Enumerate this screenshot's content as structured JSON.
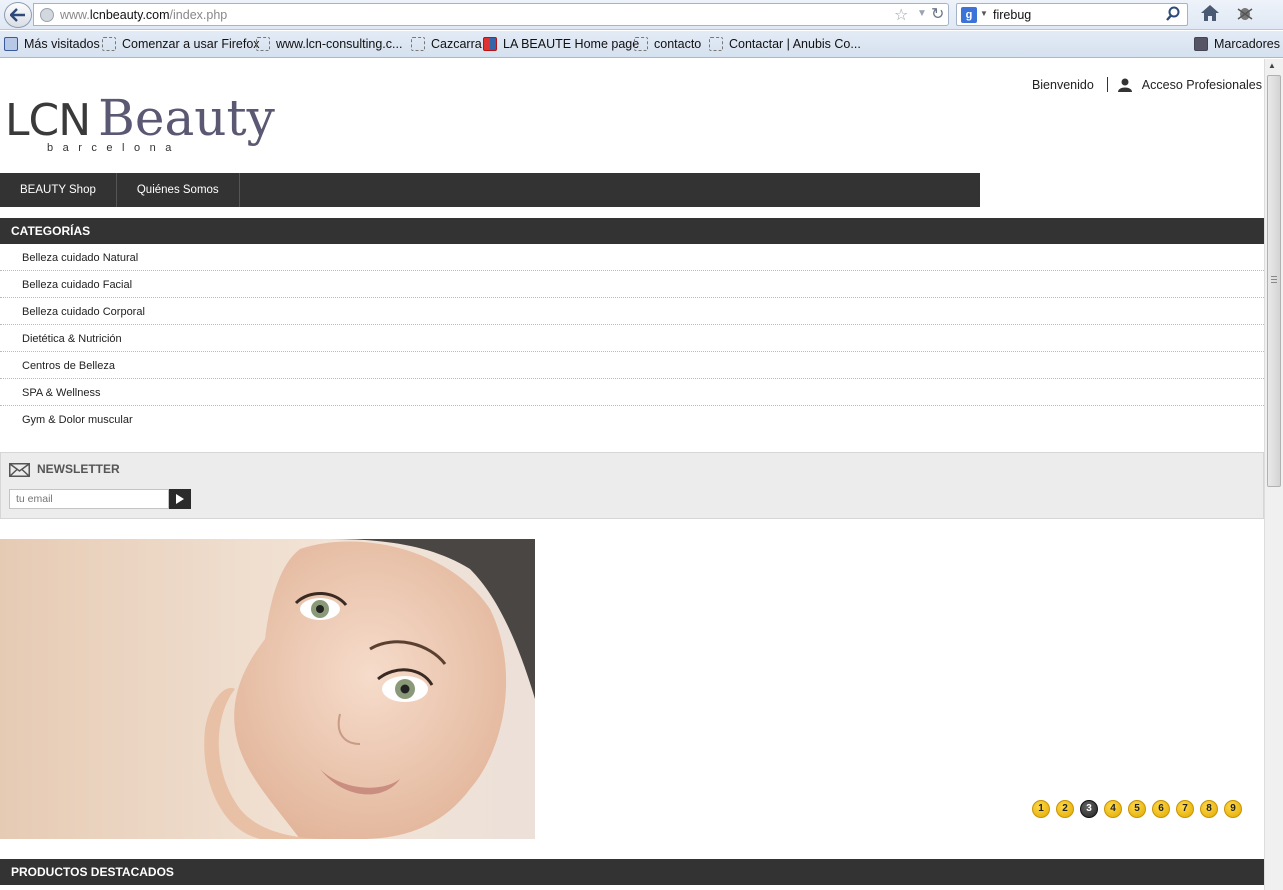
{
  "browser": {
    "url_prefix": "www.",
    "url_domain": "lcnbeauty.com",
    "url_path": "/index.php",
    "search_value": "firebug",
    "bookmarks": [
      {
        "label": "Más visitados",
        "icon": "most-visited-icon"
      },
      {
        "label": "Comenzar a usar Firefox",
        "icon": "page-icon"
      },
      {
        "label": "www.lcn-consulting.c...",
        "icon": "page-icon"
      },
      {
        "label": "Cazcarra",
        "icon": "page-icon"
      },
      {
        "label": "LA BEAUTE Home page",
        "icon": "site-icon"
      },
      {
        "label": "contacto",
        "icon": "page-icon"
      },
      {
        "label": "Contactar | Anubis Co...",
        "icon": "page-icon"
      }
    ],
    "bookmarks_menu_label": "Marcadores"
  },
  "site": {
    "logo_main": "LCN",
    "logo_accent": "Beauty",
    "logo_sub": "barcelona",
    "welcome": "Bienvenido",
    "pro_access": "Acceso Profesionales",
    "nav": [
      "BEAUTY Shop",
      "Quiénes Somos"
    ],
    "categories_title": "CATEGORÍAS",
    "categories": [
      "Belleza cuidado Natural",
      "Belleza cuidado Facial",
      "Belleza cuidado Corporal",
      "Dietética & Nutrición",
      "Centros de Belleza",
      "SPA & Wellness",
      "Gym & Dolor muscular"
    ],
    "newsletter_title": "NEWSLETTER",
    "newsletter_placeholder": "tu email",
    "slider_pages": [
      "1",
      "2",
      "3",
      "4",
      "5",
      "6",
      "7",
      "8",
      "9"
    ],
    "slider_active": "3",
    "featured_title": "PRODUCTOS DESTACADOS"
  },
  "colors": {
    "dark_bar": "#333333",
    "pager_gold": "#f2c200",
    "logo_accent": "#5a5872"
  }
}
